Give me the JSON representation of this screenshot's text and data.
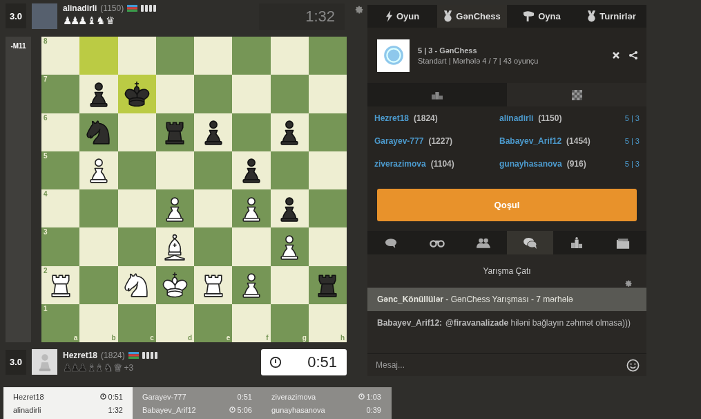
{
  "top_player": {
    "score": "3.0",
    "name": "alinadirli",
    "rating": "(1150)",
    "captured": "♟♟♟ ♝ ♞ ♛",
    "clock": "1:32",
    "active": false
  },
  "evaluation": "-M11",
  "board": {
    "files": [
      "a",
      "b",
      "c",
      "d",
      "e",
      "f",
      "g",
      "h"
    ],
    "ranks": [
      {
        "label": "8",
        "squares": [
          {
            "highlighted": false
          },
          {
            "highlighted": true
          },
          {
            "highlighted": false
          },
          {
            "highlighted": false
          },
          {
            "highlighted": false
          },
          {
            "highlighted": false
          },
          {
            "highlighted": false
          },
          {
            "highlighted": false
          }
        ]
      },
      {
        "label": "7",
        "squares": [
          {
            "highlighted": false
          },
          {
            "highlighted": false,
            "piece": {
              "kind": "pawn",
              "white": false
            }
          },
          {
            "highlighted": true,
            "piece": {
              "kind": "king",
              "white": false
            }
          },
          {
            "highlighted": false
          },
          {
            "highlighted": false
          },
          {
            "highlighted": false
          },
          {
            "highlighted": false
          },
          {
            "highlighted": false
          }
        ]
      },
      {
        "label": "6",
        "squares": [
          {
            "highlighted": false
          },
          {
            "highlighted": false,
            "piece": {
              "kind": "knight",
              "white": false
            }
          },
          {
            "highlighted": false
          },
          {
            "highlighted": false,
            "piece": {
              "kind": "rook",
              "white": false
            }
          },
          {
            "highlighted": false,
            "piece": {
              "kind": "pawn",
              "white": false
            }
          },
          {
            "highlighted": false
          },
          {
            "highlighted": false,
            "piece": {
              "kind": "pawn",
              "white": false
            }
          },
          {
            "highlighted": false
          }
        ]
      },
      {
        "label": "5",
        "squares": [
          {
            "highlighted": false
          },
          {
            "highlighted": false,
            "piece": {
              "kind": "pawn",
              "white": true
            }
          },
          {
            "highlighted": false
          },
          {
            "highlighted": false
          },
          {
            "highlighted": false
          },
          {
            "highlighted": false,
            "piece": {
              "kind": "pawn",
              "white": false
            }
          },
          {
            "highlighted": false
          },
          {
            "highlighted": false
          }
        ]
      },
      {
        "label": "4",
        "squares": [
          {
            "highlighted": false
          },
          {
            "highlighted": false
          },
          {
            "highlighted": false
          },
          {
            "highlighted": false,
            "piece": {
              "kind": "pawn",
              "white": true
            }
          },
          {
            "highlighted": false
          },
          {
            "highlighted": false,
            "piece": {
              "kind": "pawn",
              "white": true
            }
          },
          {
            "highlighted": false,
            "piece": {
              "kind": "pawn",
              "white": false
            }
          },
          {
            "highlighted": false
          }
        ]
      },
      {
        "label": "3",
        "squares": [
          {
            "highlighted": false
          },
          {
            "highlighted": false
          },
          {
            "highlighted": false
          },
          {
            "highlighted": false,
            "piece": {
              "kind": "bishop",
              "white": true
            }
          },
          {
            "highlighted": false
          },
          {
            "highlighted": false
          },
          {
            "highlighted": false,
            "piece": {
              "kind": "pawn",
              "white": true
            }
          },
          {
            "highlighted": false
          }
        ]
      },
      {
        "label": "2",
        "squares": [
          {
            "highlighted": false,
            "piece": {
              "kind": "rook",
              "white": true
            }
          },
          {
            "highlighted": false
          },
          {
            "highlighted": false,
            "piece": {
              "kind": "knight",
              "white": true
            }
          },
          {
            "highlighted": false,
            "piece": {
              "kind": "king",
              "white": true
            }
          },
          {
            "highlighted": false,
            "piece": {
              "kind": "rook",
              "white": true
            }
          },
          {
            "highlighted": false,
            "piece": {
              "kind": "pawn",
              "white": true
            }
          },
          {
            "highlighted": false
          },
          {
            "highlighted": false,
            "piece": {
              "kind": "rook",
              "white": false
            }
          }
        ]
      },
      {
        "label": "1",
        "squares": [
          {
            "highlighted": false
          },
          {
            "highlighted": false
          },
          {
            "highlighted": false
          },
          {
            "highlighted": false
          },
          {
            "highlighted": false
          },
          {
            "highlighted": false
          },
          {
            "highlighted": false
          },
          {
            "highlighted": false
          }
        ]
      }
    ]
  },
  "bottom_player": {
    "score": "3.0",
    "name": "Hezret18",
    "rating": "(1824)",
    "captured": "♟♟♟ ♝♝ ♞ ♛",
    "advantage": "+3",
    "clock": "0:51",
    "active": true
  },
  "games": [
    {
      "selected": true,
      "rows": [
        {
          "name": "Hezret18",
          "time": "0:51",
          "to_move": true
        },
        {
          "name": "alinadirli",
          "time": "1:32",
          "to_move": false
        }
      ]
    },
    {
      "selected": false,
      "rows": [
        {
          "name": "Garayev-777",
          "time": "0:51",
          "to_move": false
        },
        {
          "name": "Babayev_Arif12",
          "time": "5:06",
          "to_move": true
        }
      ]
    },
    {
      "selected": false,
      "rows": [
        {
          "name": "ziverazimova",
          "time": "1:03",
          "to_move": true
        },
        {
          "name": "gunayhasanova",
          "time": "0:39",
          "to_move": false
        }
      ]
    }
  ],
  "tabs": [
    {
      "label": "Oyun",
      "kind": "bolt",
      "selected": false
    },
    {
      "label": "GənChess",
      "kind": "medal",
      "selected": true
    },
    {
      "label": "Oyna",
      "kind": "pawn",
      "selected": false
    },
    {
      "label": "Turnirlər",
      "kind": "medal",
      "selected": false
    }
  ],
  "tournament": {
    "title": "5 | 3 - GənChess",
    "subtitle": "Standart | Mərhələ 4 / 7 | 43 oyunçu"
  },
  "subtabs": [
    {
      "kind": "podium",
      "selected": false
    },
    {
      "kind": "board",
      "selected": true
    }
  ],
  "pairings": [
    {
      "white": "Hezret18",
      "white_rating": "(1824)",
      "black": "alinadirli",
      "black_rating": "(1150)",
      "time_control": "5 | 3"
    },
    {
      "white": "Garayev-777",
      "white_rating": "(1227)",
      "black": "Babayev_Arif12",
      "black_rating": "(1454)",
      "time_control": "5 | 3"
    },
    {
      "white": "ziverazimova",
      "white_rating": "(1104)",
      "black": "gunayhasanova",
      "black_rating": "(916)",
      "time_control": "5 | 3"
    }
  ],
  "join_button": "Qoşul",
  "chat_tabs": [
    {
      "kind": "bubble",
      "selected": false
    },
    {
      "kind": "binoculars",
      "selected": false
    },
    {
      "kind": "people",
      "selected": false
    },
    {
      "kind": "bubbles",
      "selected": true
    },
    {
      "kind": "podium",
      "selected": false
    },
    {
      "kind": "folder",
      "selected": false
    }
  ],
  "chat": {
    "title": "Yarışma Çatı",
    "banner": "**Gənc_Könüllülər** - GənChess Yarışması - 7 mərhələ",
    "messages": [
      {
        "author": "Babayev_Arif12:",
        "text": "**@firavanalizade** hiləni bağlayın zəhmət olmasa)))"
      }
    ],
    "placeholder": "Mesaj..."
  }
}
